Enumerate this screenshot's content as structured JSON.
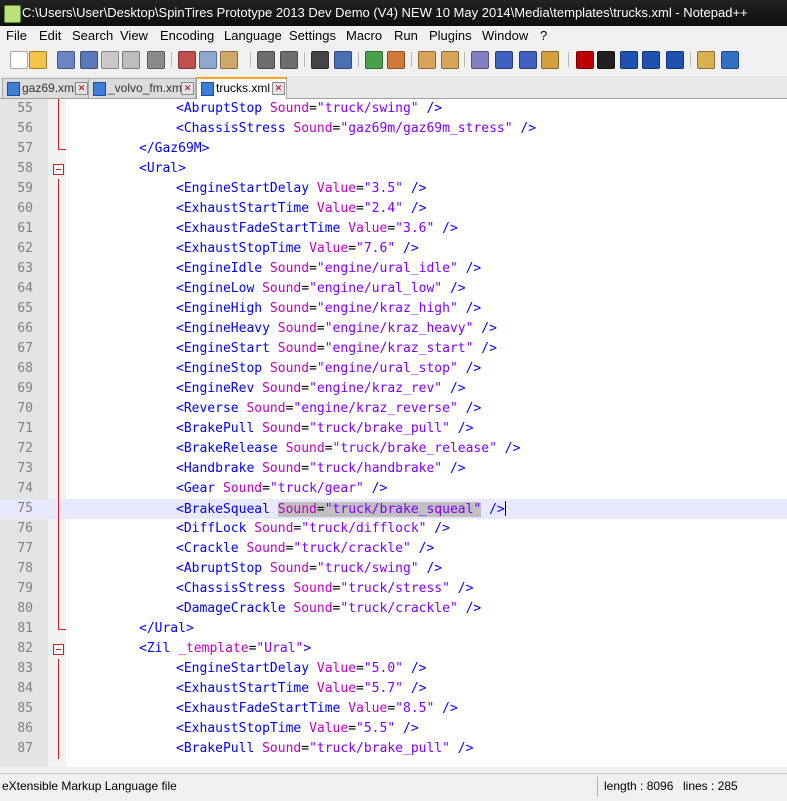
{
  "window": {
    "title": "C:\\Users\\User\\Desktop\\SpinTires Prototype 2013 Dev Demo (V4) NEW 10 May 2014\\Media\\templates\\trucks.xml - Notepad++"
  },
  "menu": [
    "File",
    "Edit",
    "Search",
    "View",
    "Encoding",
    "Language",
    "Settings",
    "Macro",
    "Run",
    "Plugins",
    "Window",
    "?"
  ],
  "toolbar_icons": [
    "new-file-icon",
    "open-file-icon",
    "save-icon",
    "save-all-icon",
    "close-icon",
    "close-all-icon",
    "print-icon",
    "cut-icon",
    "copy-icon",
    "paste-icon",
    "undo-icon",
    "redo-icon",
    "find-icon",
    "replace-icon",
    "zoom-in-icon",
    "zoom-out-icon",
    "sync-vertical-icon",
    "sync-horizontal-icon",
    "word-wrap-icon",
    "show-all-chars-icon",
    "indent-guide-icon",
    "user-language-icon",
    "record-macro-icon",
    "stop-macro-icon",
    "play-macro-icon",
    "run-macro-multiple-icon",
    "save-macro-icon",
    "open-folder-icon",
    "spell-check-icon"
  ],
  "tabs": [
    {
      "label": "gaz69.xml",
      "active": false
    },
    {
      "label": "_volvo_fm.xml",
      "active": false
    },
    {
      "label": "trucks.xml",
      "active": true
    }
  ],
  "editor": {
    "lines": [
      {
        "num": "55",
        "indent": 3,
        "tag": "<AbruptStop",
        "attr": "Sound",
        "val": "\"truck/swing\"",
        "close": " />"
      },
      {
        "num": "56",
        "indent": 3,
        "tag": "<ChassisStress",
        "attr": "Sound",
        "val": "\"gaz69m/gaz69m_stress\"",
        "close": " />"
      },
      {
        "num": "57",
        "indent": 2,
        "tag": "</Gaz69M>",
        "attr": "",
        "val": "",
        "close": ""
      },
      {
        "num": "58",
        "indent": 2,
        "tag": "<Ural>",
        "attr": "",
        "val": "",
        "close": ""
      },
      {
        "num": "59",
        "indent": 3,
        "tag": "<EngineStartDelay",
        "attr": "Value",
        "val": "\"3.5\"",
        "close": " />"
      },
      {
        "num": "60",
        "indent": 3,
        "tag": "<ExhaustStartTime",
        "attr": "Value",
        "val": "\"2.4\"",
        "close": " />"
      },
      {
        "num": "61",
        "indent": 3,
        "tag": "<ExhaustFadeStartTime",
        "attr": "Value",
        "val": "\"3.6\"",
        "close": " />"
      },
      {
        "num": "62",
        "indent": 3,
        "tag": "<ExhaustStopTime",
        "attr": "Value",
        "val": "\"7.6\"",
        "close": " />"
      },
      {
        "num": "63",
        "indent": 3,
        "tag": "<EngineIdle",
        "attr": "Sound",
        "val": "\"engine/ural_idle\"",
        "close": " />"
      },
      {
        "num": "64",
        "indent": 3,
        "tag": "<EngineLow",
        "attr": "Sound",
        "val": "\"engine/ural_low\"",
        "close": " />"
      },
      {
        "num": "65",
        "indent": 3,
        "tag": "<EngineHigh",
        "attr": "Sound",
        "val": "\"engine/kraz_high\"",
        "close": " />"
      },
      {
        "num": "66",
        "indent": 3,
        "tag": "<EngineHeavy",
        "attr": "Sound",
        "val": "\"engine/kraz_heavy\"",
        "close": " />"
      },
      {
        "num": "67",
        "indent": 3,
        "tag": "<EngineStart",
        "attr": "Sound",
        "val": "\"engine/kraz_start\"",
        "close": " />"
      },
      {
        "num": "68",
        "indent": 3,
        "tag": "<EngineStop",
        "attr": "Sound",
        "val": "\"engine/ural_stop\"",
        "close": " />"
      },
      {
        "num": "69",
        "indent": 3,
        "tag": "<EngineRev",
        "attr": "Sound",
        "val": "\"engine/kraz_rev\"",
        "close": " />"
      },
      {
        "num": "70",
        "indent": 3,
        "tag": "<Reverse",
        "attr": "Sound",
        "val": "\"engine/kraz_reverse\"",
        "close": " />"
      },
      {
        "num": "71",
        "indent": 3,
        "tag": "<BrakePull",
        "attr": "Sound",
        "val": "\"truck/brake_pull\"",
        "close": " />"
      },
      {
        "num": "72",
        "indent": 3,
        "tag": "<BrakeRelease",
        "attr": "Sound",
        "val": "\"truck/brake_release\"",
        "close": " />"
      },
      {
        "num": "73",
        "indent": 3,
        "tag": "<Handbrake",
        "attr": "Sound",
        "val": "\"truck/handbrake\"",
        "close": " />"
      },
      {
        "num": "74",
        "indent": 3,
        "tag": "<Gear",
        "attr": "Sound",
        "val": "\"truck/gear\"",
        "close": " />"
      },
      {
        "num": "75",
        "indent": 3,
        "tag": "<BrakeSqueal",
        "attr": "Sound",
        "val": "\"truck/brake_squeal\"",
        "close": " />"
      },
      {
        "num": "76",
        "indent": 3,
        "tag": "<DiffLock",
        "attr": "Sound",
        "val": "\"truck/difflock\"",
        "close": " />"
      },
      {
        "num": "77",
        "indent": 3,
        "tag": "<Crackle",
        "attr": "Sound",
        "val": "\"truck/crackle\"",
        "close": " />"
      },
      {
        "num": "78",
        "indent": 3,
        "tag": "<AbruptStop",
        "attr": "Sound",
        "val": "\"truck/swing\"",
        "close": " />"
      },
      {
        "num": "79",
        "indent": 3,
        "tag": "<ChassisStress",
        "attr": "Sound",
        "val": "\"truck/stress\"",
        "close": " />"
      },
      {
        "num": "80",
        "indent": 3,
        "tag": "<DamageCrackle",
        "attr": "Sound",
        "val": "\"truck/crackle\"",
        "close": " />"
      },
      {
        "num": "81",
        "indent": 2,
        "tag": "</Ural>",
        "attr": "",
        "val": "",
        "close": ""
      },
      {
        "num": "82",
        "indent": 2,
        "tag": "<Zil",
        "attr": "_template",
        "val": "\"Ural\"",
        "close": ">"
      },
      {
        "num": "83",
        "indent": 3,
        "tag": "<EngineStartDelay",
        "attr": "Value",
        "val": "\"5.0\"",
        "close": " />"
      },
      {
        "num": "84",
        "indent": 3,
        "tag": "<ExhaustStartTime",
        "attr": "Value",
        "val": "\"5.7\"",
        "close": " />"
      },
      {
        "num": "85",
        "indent": 3,
        "tag": "<ExhaustFadeStartTime",
        "attr": "Value",
        "val": "\"8.5\"",
        "close": " />"
      },
      {
        "num": "86",
        "indent": 3,
        "tag": "<ExhaustStopTime",
        "attr": "Value",
        "val": "\"5.5\"",
        "close": " />"
      },
      {
        "num": "87",
        "indent": 3,
        "tag": "<BrakePull",
        "attr": "Sound",
        "val": "\"truck/brake_pull\"",
        "close": " />"
      }
    ],
    "current_line": "75"
  },
  "status": {
    "file_type": "eXtensible Markup Language file",
    "length": "length : 8096",
    "lines": "lines : 285"
  },
  "colors": {
    "tag": "#0000ff",
    "attribute": "#c000c0",
    "value": "#8000ff",
    "fold_marker": "#d02020",
    "current_line": "#e8e8ff"
  }
}
